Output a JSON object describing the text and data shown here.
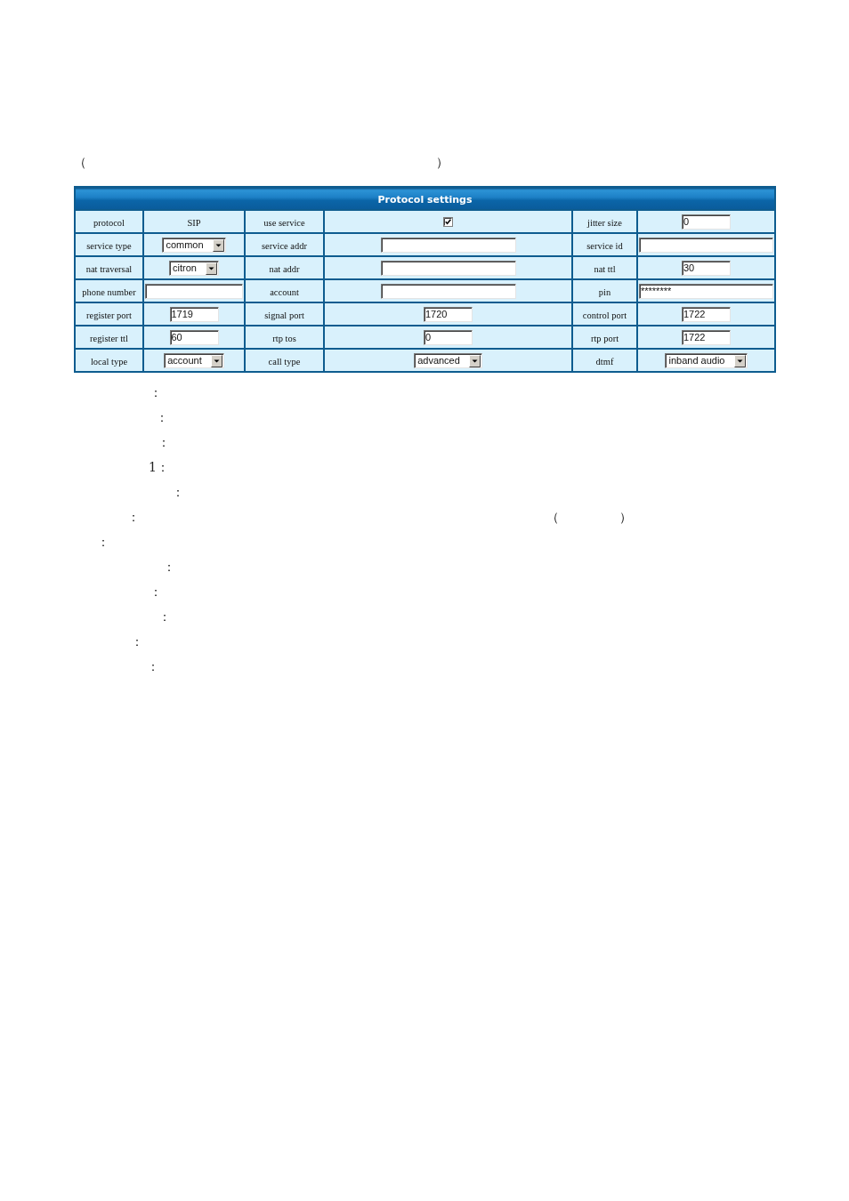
{
  "heading_line": [
    "（",
    "）"
  ],
  "table": {
    "title": "Protocol settings",
    "rows": [
      {
        "cells": [
          {
            "kind": "label",
            "text": "protocol"
          },
          {
            "kind": "text",
            "text": "SIP"
          },
          {
            "kind": "label",
            "text": "use service"
          },
          {
            "kind": "checkbox",
            "checked": true
          },
          {
            "kind": "label",
            "text": "jitter size"
          },
          {
            "kind": "input",
            "value": "0"
          }
        ]
      },
      {
        "cells": [
          {
            "kind": "label",
            "text": "service type"
          },
          {
            "kind": "select",
            "value": "common"
          },
          {
            "kind": "label",
            "text": "service addr"
          },
          {
            "kind": "input"
          },
          {
            "kind": "label",
            "text": "service id"
          },
          {
            "kind": "input"
          }
        ]
      },
      {
        "cells": [
          {
            "kind": "label",
            "text": "nat traversal"
          },
          {
            "kind": "select",
            "value": "citron"
          },
          {
            "kind": "label",
            "text": "nat addr"
          },
          {
            "kind": "input"
          },
          {
            "kind": "label",
            "text": "nat ttl"
          },
          {
            "kind": "input",
            "value": "30"
          }
        ]
      },
      {
        "cells": [
          {
            "kind": "label",
            "text": "phone number"
          },
          {
            "kind": "input"
          },
          {
            "kind": "label",
            "text": "account"
          },
          {
            "kind": "input"
          },
          {
            "kind": "label",
            "text": "pin"
          },
          {
            "kind": "password",
            "value": "********"
          }
        ]
      },
      {
        "cells": [
          {
            "kind": "label",
            "text": "register port"
          },
          {
            "kind": "input",
            "value": "1719"
          },
          {
            "kind": "label",
            "text": "signal port"
          },
          {
            "kind": "input",
            "value": "1720"
          },
          {
            "kind": "label",
            "text": "control port"
          },
          {
            "kind": "input",
            "value": "1722"
          }
        ]
      },
      {
        "cells": [
          {
            "kind": "label",
            "text": "register ttl"
          },
          {
            "kind": "input",
            "value": "60"
          },
          {
            "kind": "label",
            "text": "rtp tos"
          },
          {
            "kind": "input",
            "value": "0"
          },
          {
            "kind": "label",
            "text": "rtp port"
          },
          {
            "kind": "input",
            "value": "1722"
          }
        ]
      },
      {
        "cells": [
          {
            "kind": "label",
            "text": "local type"
          },
          {
            "kind": "select",
            "value": "account"
          },
          {
            "kind": "label",
            "text": "call type"
          },
          {
            "kind": "select",
            "value": "advanced"
          },
          {
            "kind": "label",
            "text": "dtmf"
          },
          {
            "kind": "select",
            "value": "inband audio"
          }
        ]
      }
    ]
  },
  "note_lines": [
    [
      "："
    ],
    [
      "："
    ],
    [
      "："
    ],
    [
      "1："
    ],
    [
      "："
    ],
    [
      "：",
      "（",
      "）"
    ],
    [
      "："
    ],
    [
      "："
    ],
    [
      "："
    ],
    [
      "："
    ],
    [
      "："
    ],
    [
      "："
    ]
  ]
}
